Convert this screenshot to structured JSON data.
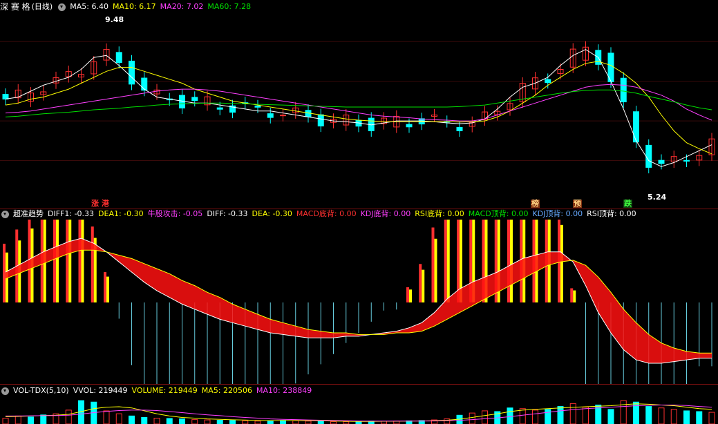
{
  "main": {
    "name": "深 赛 格",
    "period": "(日线)",
    "ma": [
      {
        "label": "MA5: 6.40",
        "color": "#ffffff"
      },
      {
        "label": "MA10: 6.17",
        "color": "#ffff00"
      },
      {
        "label": "MA20: 7.02",
        "color": "#ff40ff"
      },
      {
        "label": "MA60: 7.28",
        "color": "#00e000"
      }
    ],
    "high_label": "9.48",
    "low_label": "5.24",
    "signals": [
      {
        "text": "涨 港",
        "color": "#ff3030",
        "bg": "#000000"
      },
      {
        "text": "榜",
        "color": "#ffd080",
        "bg": "#803010"
      },
      {
        "text": "预",
        "color": "#ffd080",
        "bg": "#803010"
      },
      {
        "text": "跌",
        "color": "#40ff40",
        "bg": "#104010"
      }
    ]
  },
  "macd": {
    "title": "超准趋势",
    "items": [
      {
        "label": "DIFF1: -0.33",
        "color": "#ffffff"
      },
      {
        "label": "DEA1: -0.30",
        "color": "#ffff00"
      },
      {
        "label": "牛股攻击: -0.05",
        "color": "#ff40ff"
      },
      {
        "label": "DIFF: -0.33",
        "color": "#ffffff"
      },
      {
        "label": "DEA: -0.30",
        "color": "#ffff00"
      },
      {
        "label": "MACD底背: 0.00",
        "color": "#ff3030"
      },
      {
        "label": "KDJ底背: 0.00",
        "color": "#ff40ff"
      },
      {
        "label": "RSI底背: 0.00",
        "color": "#ffff00"
      },
      {
        "label": "MACD顶背: 0.00",
        "color": "#00e000"
      },
      {
        "label": "KDJ顶背: 0.00",
        "color": "#66aaff"
      },
      {
        "label": "RSI顶背: 0.00",
        "color": "#ffffff"
      }
    ]
  },
  "vol": {
    "title": "VOL-TDX(5,10)",
    "items": [
      {
        "label": "VVOL: 219449",
        "color": "#ffffff"
      },
      {
        "label": "VOLUME: 219449",
        "color": "#ffff00"
      },
      {
        "label": "MA5: 220506",
        "color": "#ffff00"
      },
      {
        "label": "MA10: 238849",
        "color": "#ff40ff"
      }
    ]
  },
  "colors": {
    "up": "#ff3030",
    "down": "#00ffff",
    "separator": "#7a1010"
  },
  "chart_data": [
    {
      "type": "candlestick",
      "title": "深 赛 格 (日线)",
      "ylim": [
        5.0,
        9.7
      ],
      "marked_high": 9.48,
      "marked_low": 5.24,
      "series": [
        {
          "name": "MA5",
          "values": [
            7.55,
            7.6,
            7.75,
            7.9,
            8.0,
            8.1,
            8.3,
            8.6,
            8.65,
            8.4,
            8.1,
            7.8,
            7.6,
            7.55,
            7.5,
            7.45,
            7.45,
            7.4,
            7.35,
            7.3,
            7.25,
            7.25,
            7.2,
            7.15,
            7.1,
            7.05,
            7.0,
            6.98,
            6.95,
            6.9,
            6.95,
            7.0,
            7.0,
            7.0,
            6.98,
            6.95,
            6.93,
            6.95,
            7.05,
            7.3,
            7.6,
            7.85,
            7.95,
            8.1,
            8.4,
            8.65,
            8.8,
            8.6,
            8.0,
            7.3,
            6.5,
            6.0,
            5.85,
            5.95,
            6.1,
            6.25,
            6.4
          ]
        },
        {
          "name": "MA10",
          "values": [
            7.4,
            7.45,
            7.55,
            7.6,
            7.7,
            7.8,
            7.95,
            8.1,
            8.25,
            8.35,
            8.35,
            8.25,
            8.15,
            8.05,
            7.95,
            7.8,
            7.7,
            7.6,
            7.5,
            7.45,
            7.4,
            7.35,
            7.3,
            7.25,
            7.2,
            7.15,
            7.1,
            7.05,
            7.02,
            7.0,
            6.98,
            6.98,
            6.98,
            6.98,
            6.98,
            6.98,
            6.97,
            6.98,
            7.0,
            7.1,
            7.25,
            7.45,
            7.65,
            7.9,
            8.1,
            8.3,
            8.45,
            8.5,
            8.4,
            8.2,
            7.95,
            7.6,
            7.15,
            6.75,
            6.45,
            6.3,
            6.17
          ]
        },
        {
          "name": "MA20",
          "values": [
            7.2,
            7.22,
            7.25,
            7.3,
            7.35,
            7.4,
            7.45,
            7.5,
            7.55,
            7.6,
            7.65,
            7.7,
            7.75,
            7.78,
            7.8,
            7.8,
            7.78,
            7.75,
            7.7,
            7.65,
            7.6,
            7.55,
            7.5,
            7.45,
            7.4,
            7.35,
            7.3,
            7.25,
            7.2,
            7.15,
            7.12,
            7.1,
            7.08,
            7.05,
            7.03,
            7.02,
            7.0,
            7.0,
            7.05,
            7.15,
            7.25,
            7.35,
            7.45,
            7.55,
            7.65,
            7.75,
            7.85,
            7.9,
            7.92,
            7.9,
            7.85,
            7.75,
            7.65,
            7.5,
            7.3,
            7.15,
            7.02
          ]
        },
        {
          "name": "MA60",
          "values": [
            7.1,
            7.12,
            7.15,
            7.18,
            7.2,
            7.22,
            7.25,
            7.28,
            7.3,
            7.32,
            7.35,
            7.37,
            7.4,
            7.42,
            7.43,
            7.44,
            7.45,
            7.45,
            7.44,
            7.43,
            7.42,
            7.41,
            7.4,
            7.39,
            7.38,
            7.37,
            7.36,
            7.35,
            7.35,
            7.35,
            7.35,
            7.35,
            7.35,
            7.35,
            7.35,
            7.35,
            7.36,
            7.38,
            7.4,
            7.45,
            7.5,
            7.55,
            7.6,
            7.65,
            7.7,
            7.74,
            7.77,
            7.78,
            7.78,
            7.75,
            7.7,
            7.62,
            7.55,
            7.48,
            7.4,
            7.33,
            7.28
          ]
        }
      ]
    },
    {
      "type": "bar",
      "title": "超准趋势",
      "ylim": [
        -0.45,
        0.45
      ],
      "series": [
        {
          "name": "DIFF",
          "values": [
            0.18,
            0.22,
            0.26,
            0.3,
            0.33,
            0.36,
            0.38,
            0.35,
            0.3,
            0.24,
            0.18,
            0.12,
            0.07,
            0.03,
            -0.01,
            -0.04,
            -0.07,
            -0.1,
            -0.12,
            -0.14,
            -0.16,
            -0.18,
            -0.19,
            -0.2,
            -0.21,
            -0.21,
            -0.21,
            -0.2,
            -0.2,
            -0.19,
            -0.18,
            -0.17,
            -0.15,
            -0.12,
            -0.06,
            0.02,
            0.08,
            0.12,
            0.15,
            0.18,
            0.22,
            0.26,
            0.28,
            0.3,
            0.3,
            0.24,
            0.1,
            -0.06,
            -0.18,
            -0.28,
            -0.34,
            -0.36,
            -0.36,
            -0.35,
            -0.34,
            -0.33,
            -0.33
          ]
        },
        {
          "name": "DEA",
          "values": [
            0.14,
            0.17,
            0.2,
            0.23,
            0.26,
            0.29,
            0.31,
            0.31,
            0.3,
            0.28,
            0.26,
            0.23,
            0.2,
            0.17,
            0.13,
            0.1,
            0.06,
            0.03,
            -0.01,
            -0.04,
            -0.07,
            -0.1,
            -0.12,
            -0.14,
            -0.16,
            -0.17,
            -0.18,
            -0.18,
            -0.19,
            -0.19,
            -0.19,
            -0.18,
            -0.18,
            -0.17,
            -0.14,
            -0.1,
            -0.06,
            -0.02,
            0.02,
            0.06,
            0.1,
            0.14,
            0.18,
            0.22,
            0.24,
            0.25,
            0.22,
            0.15,
            0.06,
            -0.04,
            -0.12,
            -0.19,
            -0.24,
            -0.27,
            -0.29,
            -0.3,
            -0.3
          ]
        }
      ]
    },
    {
      "type": "bar",
      "title": "VOL-TDX(5,10)",
      "series": [
        {
          "name": "VOLUME",
          "values": [
            40,
            55,
            48,
            62,
            70,
            95,
            160,
            150,
            90,
            70,
            55,
            45,
            40,
            38,
            35,
            30,
            28,
            26,
            25,
            22,
            20,
            22,
            25,
            24,
            20,
            18,
            17,
            16,
            18,
            20,
            19,
            20,
            22,
            24,
            28,
            35,
            60,
            75,
            90,
            85,
            110,
            105,
            95,
            100,
            120,
            140,
            115,
            130,
            100,
            160,
            150,
            120,
            110,
            100,
            90,
            85,
            80
          ]
        },
        {
          "name": "MA5",
          "values": [
            50,
            52,
            55,
            58,
            60,
            66,
            85,
            105,
            115,
            118,
            110,
            90,
            70,
            55,
            45,
            40,
            35,
            32,
            29,
            27,
            24,
            23,
            23,
            23,
            22,
            22,
            20,
            19,
            18,
            18,
            19,
            19,
            20,
            21,
            23,
            26,
            33,
            45,
            58,
            70,
            85,
            95,
            100,
            105,
            110,
            114,
            118,
            122,
            125,
            132,
            138,
            135,
            130,
            125,
            115,
            105,
            100
          ]
        },
        {
          "name": "MA10",
          "values": [
            55,
            55,
            56,
            57,
            58,
            60,
            68,
            78,
            86,
            92,
            95,
            95,
            92,
            85,
            78,
            70,
            63,
            57,
            50,
            45,
            40,
            35,
            32,
            30,
            28,
            26,
            24,
            22,
            21,
            20,
            20,
            20,
            20,
            20,
            21,
            22,
            25,
            30,
            36,
            42,
            50,
            60,
            70,
            80,
            90,
            98,
            105,
            110,
            115,
            120,
            125,
            128,
            130,
            130,
            126,
            120,
            115
          ]
        }
      ]
    }
  ]
}
